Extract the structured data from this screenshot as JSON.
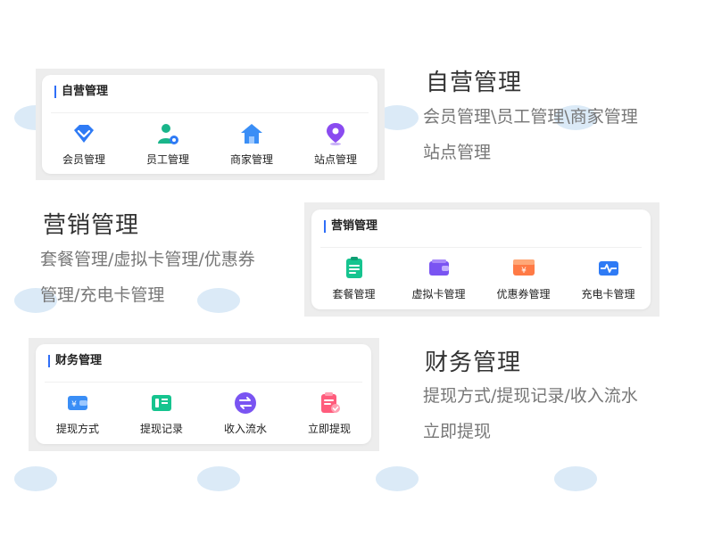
{
  "sections": [
    {
      "title": "自营管理",
      "desc_lines": [
        "会员管理\\员工管理\\商家管理",
        "站点管理"
      ],
      "card": {
        "header": "自营管理",
        "items": [
          {
            "label": "会员管理",
            "icon": "vip-diamond-icon"
          },
          {
            "label": "员工管理",
            "icon": "staff-gear-icon"
          },
          {
            "label": "商家管理",
            "icon": "house-icon"
          },
          {
            "label": "站点管理",
            "icon": "location-pin-icon"
          }
        ]
      }
    },
    {
      "title": "营销管理",
      "desc_lines": [
        "套餐管理/虚拟卡管理/优惠券",
        "管理/充电卡管理"
      ],
      "card": {
        "header": "营销管理",
        "items": [
          {
            "label": "套餐管理",
            "icon": "checklist-icon"
          },
          {
            "label": "虚拟卡管理",
            "icon": "wallet-card-icon"
          },
          {
            "label": "优惠券管理",
            "icon": "coupon-yen-icon"
          },
          {
            "label": "充电卡管理",
            "icon": "pulse-card-icon"
          }
        ]
      }
    },
    {
      "title": "财务管理",
      "desc_lines": [
        "提现方式/提现记录/收入流水",
        "立即提现"
      ],
      "card": {
        "header": "财务管理",
        "items": [
          {
            "label": "提现方式",
            "icon": "yen-wallet-icon"
          },
          {
            "label": "提现记录",
            "icon": "receipt-card-icon"
          },
          {
            "label": "收入流水",
            "icon": "exchange-arrows-icon"
          },
          {
            "label": "立即提现",
            "icon": "clipboard-check-icon"
          }
        ]
      }
    }
  ],
  "colors": {
    "accent": "#2f6ef7",
    "frame": "#ededed"
  }
}
